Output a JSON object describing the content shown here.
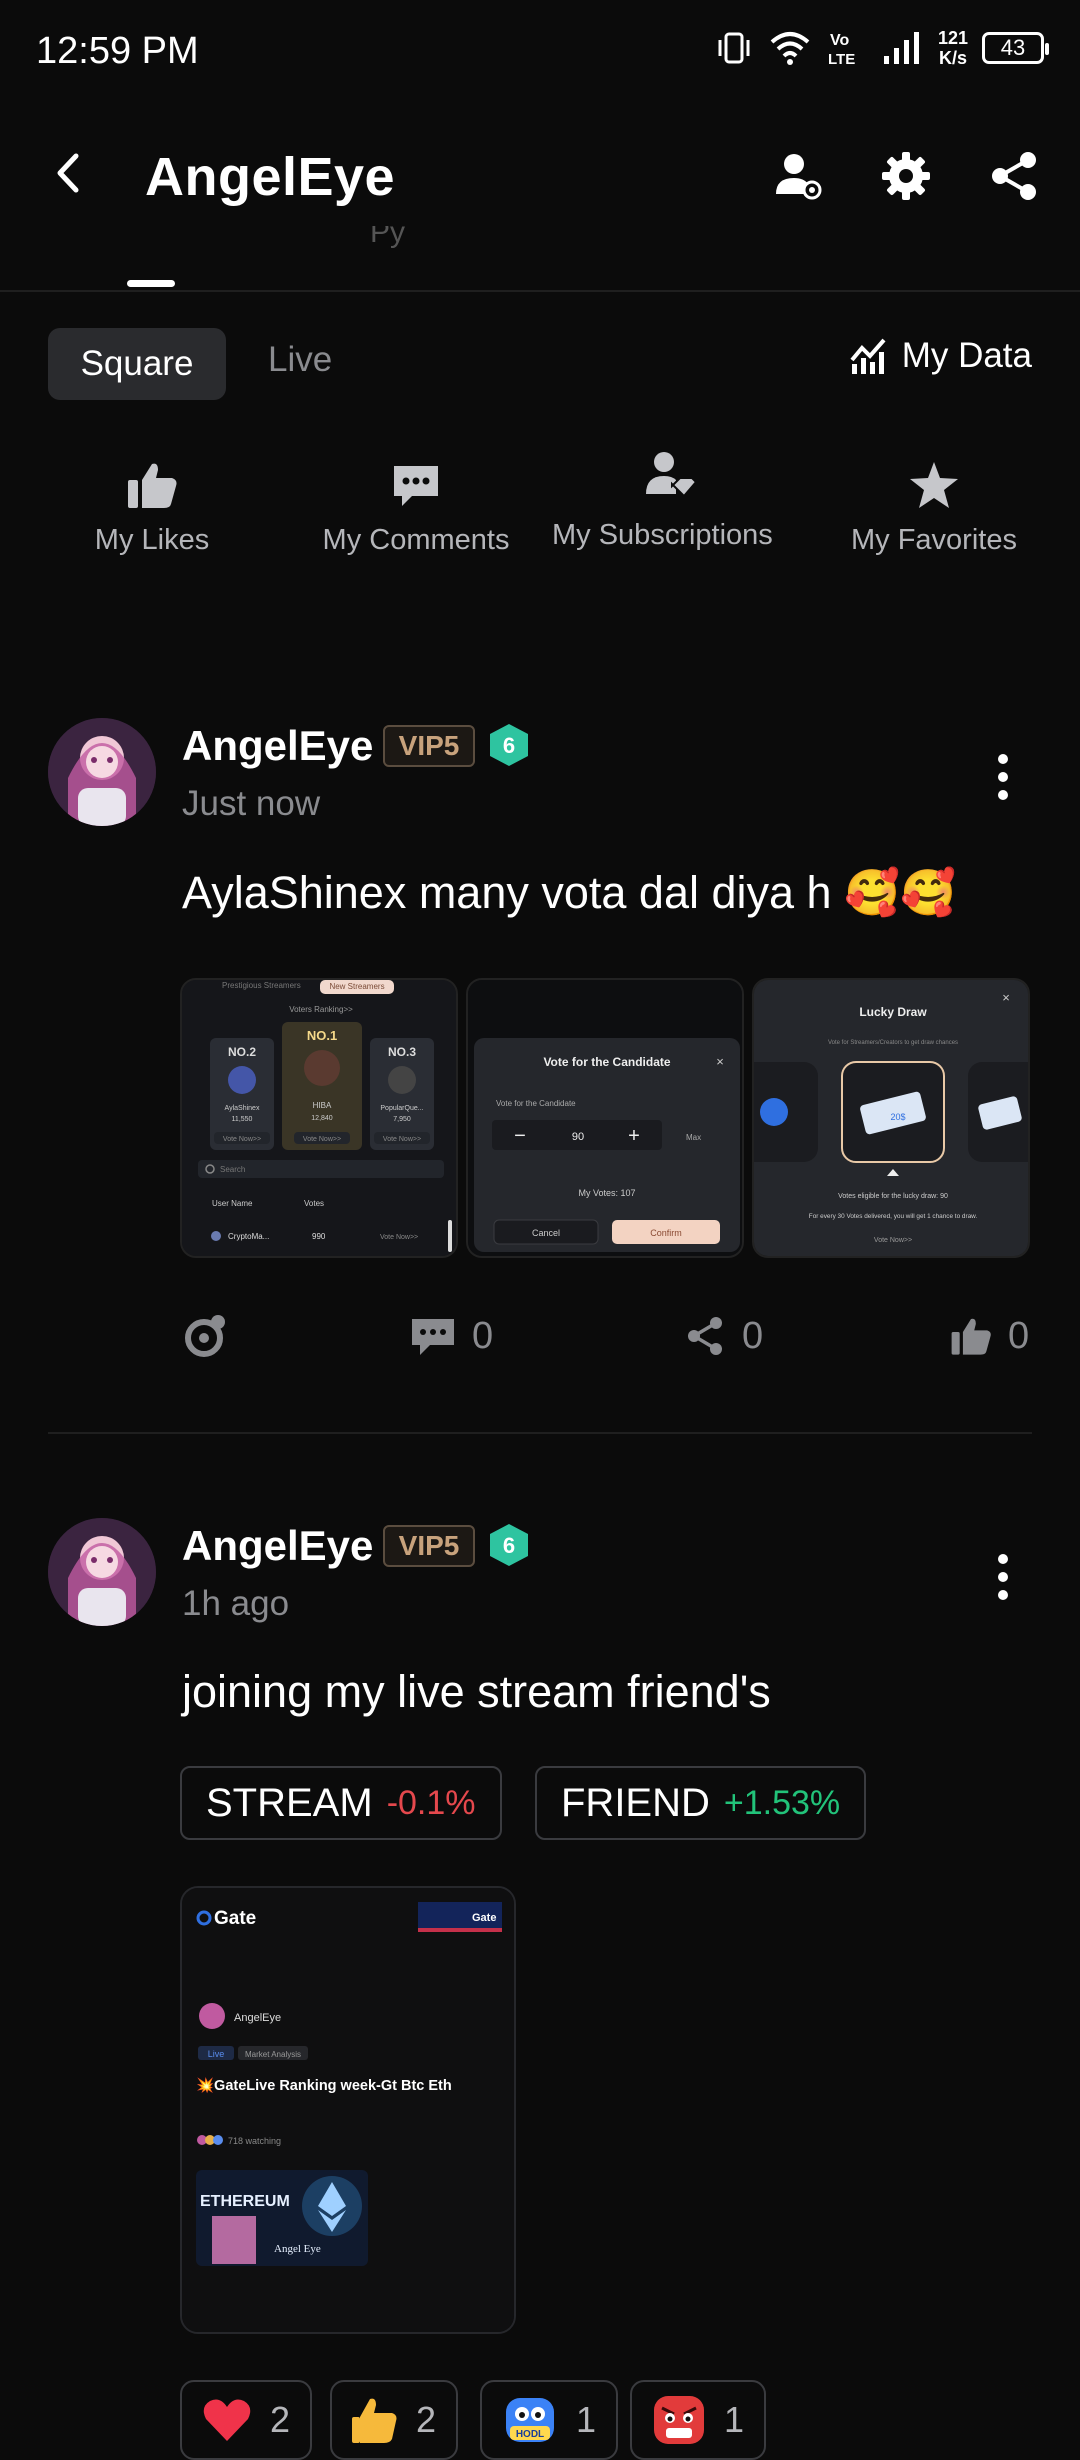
{
  "status_bar": {
    "time": "12:59 PM",
    "speed_value": "121",
    "speed_unit": "K/s",
    "battery": "43"
  },
  "header": {
    "title": "AngelEye",
    "icons": [
      "back-arrow-icon",
      "user-settings-icon",
      "gear-icon",
      "share-icon"
    ]
  },
  "tabs": {
    "partial_label": "Py"
  },
  "segment": {
    "items": [
      "Square",
      "Live"
    ],
    "selected": "Square",
    "my_data": "My Data"
  },
  "quick_actions": [
    {
      "label": "My Likes",
      "icon": "thumbs-up-icon"
    },
    {
      "label": "My Comments",
      "icon": "comment-icon"
    },
    {
      "label": "My Subscriptions",
      "icon": "subscriptions-icon"
    },
    {
      "label": "My Favorites",
      "icon": "star-icon"
    }
  ],
  "posts": [
    {
      "author": "AngelEye",
      "vip": "VIP5",
      "level": "6",
      "time": "Just now",
      "text": "AylaShinex many vota dal diya h 🥰🥰",
      "images": {
        "img1": {
          "top_tabs": [
            "Prestigious Streamers",
            "New Streamers"
          ],
          "heading": "Voters Ranking>>",
          "ranks": [
            {
              "rank": "NO.2",
              "name": "AylaShinex",
              "votes": "11,550",
              "action": "Vote Now>>"
            },
            {
              "rank": "NO.1",
              "name": "HIBA",
              "votes": "12,840",
              "action": "Vote Now>>"
            },
            {
              "rank": "NO.3",
              "name": "PopularQue...",
              "votes": "7,950",
              "action": "Vote Now>>"
            }
          ],
          "search": "Search",
          "col_user": "User Name",
          "col_votes": "Votes",
          "row_user": "CryptoMa...",
          "row_votes": "990",
          "row_action": "Vote Now>>"
        },
        "img2": {
          "title": "Vote for the Candidate",
          "label": "Vote for the Candidate",
          "value": "90",
          "max": "Max",
          "my_votes": "My Votes: 107",
          "cancel": "Cancel",
          "confirm": "Confirm"
        },
        "img3": {
          "title": "Lucky Draw",
          "subtitle": "Vote for Streamers/Creators to get draw chances",
          "ticket": "20$",
          "eligible": "Votes eligible for the lucky draw: 90",
          "note": "For every 30 Votes delivered, you will get 1 chance to draw.",
          "link": "Vote Now>>"
        }
      },
      "stats": {
        "comments": "0",
        "shares": "0",
        "likes": "0"
      }
    },
    {
      "author": "AngelEye",
      "vip": "VIP5",
      "level": "6",
      "time": "1h ago",
      "text": "joining my live stream friend's",
      "tags": [
        {
          "symbol": "STREAM",
          "change": "-0.1%",
          "color": "#e5484d"
        },
        {
          "symbol": "FRIEND",
          "change": "+1.53%",
          "color": "#22c37a"
        }
      ],
      "live_card": {
        "brand": "Gate",
        "author": "AngelEye",
        "live_label": "Live",
        "category": "Market Analysis",
        "title": "💥GateLive Ranking week-Gt Btc Eth",
        "watching": "718 watching",
        "thumb_title": "ETHEREUM",
        "thumb_sub": "Angel Eye"
      },
      "reactions": [
        {
          "icon": "heart-icon",
          "count": "2"
        },
        {
          "icon": "thumbs-up-emoji-icon",
          "count": "2"
        },
        {
          "icon": "hodl-emoji-icon",
          "count": "1",
          "label": "HODL"
        },
        {
          "icon": "angry-emoji-icon",
          "count": "1"
        }
      ]
    }
  ],
  "colors": {
    "background": "#0b0b0b",
    "negative": "#e5484d",
    "positive": "#22c37a",
    "vip_gold": "#c8a27c",
    "level_badge": "#2ec4a0"
  }
}
